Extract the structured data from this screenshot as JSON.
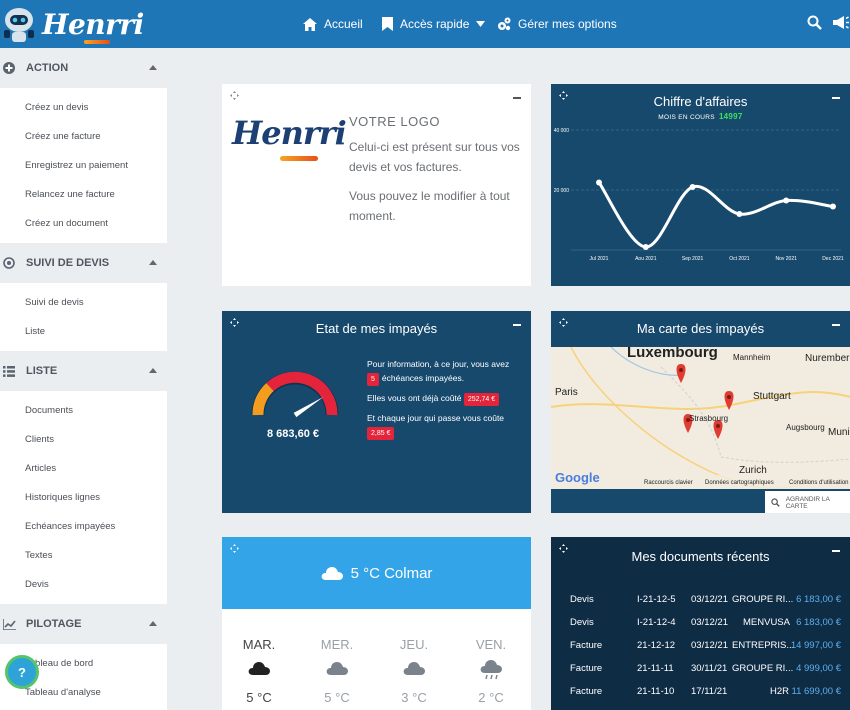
{
  "brand": {
    "name": "Henrri"
  },
  "nav": {
    "home_label": "Accueil",
    "quick_label": "Accès rapide",
    "options_label": "Gérer mes options"
  },
  "icons": {
    "home": "home-icon",
    "bookmark": "bookmark-icon",
    "caret": "caret-down-icon",
    "cogs": "cogs-icon",
    "search": "search-icon",
    "megaphone": "megaphone-icon",
    "drag": "move-icon",
    "minus": "minimize-icon",
    "cloud": "cloud-icon"
  },
  "sidebar": {
    "sections": [
      {
        "title": "ACTION",
        "icon": "plus-circle-icon",
        "items": [
          "Créez un devis",
          "Créez une facture",
          "Enregistrez un paiement",
          "Relancez une facture",
          "Créez un document"
        ]
      },
      {
        "title": "SUIVI DE DEVIS",
        "icon": "target-icon",
        "items": [
          "Suivi de devis",
          "Liste"
        ]
      },
      {
        "title": "LISTE",
        "icon": "list-icon",
        "items": [
          "Documents",
          "Clients",
          "Articles",
          "Historiques lignes",
          "Echéances impayées",
          "Textes",
          "Devis"
        ]
      },
      {
        "title": "PILOTAGE",
        "icon": "chart-icon",
        "items": [
          "Tableau de bord",
          "Tableau d'analyse"
        ]
      }
    ],
    "help_label": "?"
  },
  "logo_card": {
    "title": "VOTRE LOGO",
    "line1": "Celui-ci est présent sur tous vos devis et vos factures.",
    "line2": "Vous pouvez le modifier à tout moment."
  },
  "revenue_card": {
    "title": "Chiffre d'affaires",
    "subtitle": "MOIS EN COURS",
    "current": "14997"
  },
  "chart_data": {
    "type": "line",
    "title": "Chiffre d'affaires",
    "categories": [
      "Jul 2021",
      "Aou 2021",
      "Sep 2021",
      "Oct 2021",
      "Nov 2021",
      "Dec 2021"
    ],
    "series": [
      {
        "values": [
          22500,
          1000,
          21000,
          12000,
          16500,
          14500
        ]
      }
    ],
    "yticks": [
      "40 000",
      "20 000"
    ],
    "ylim": [
      0,
      40000
    ],
    "grid": true,
    "colors": {
      "line": "#ffffff",
      "grid": "#3e6b8c"
    }
  },
  "impayes_card": {
    "title": "Etat de mes impayés",
    "amount": "8 683,60 €",
    "info_pre": "Pour information, à ce jour, vous avez",
    "count": "5",
    "info_post": "échéances impayées.",
    "cost_label": "Elles vous ont déjà coûté",
    "cost": "252,74 €",
    "daily_label": "Et chaque jour qui passe vous coûte",
    "daily": "2,85 €",
    "gauge_level": 0.82
  },
  "map_card": {
    "title": "Ma carte des impayés",
    "places": [
      "Luxembourg",
      "Mannheim",
      "Nuremberg",
      "Paris",
      "Stuttgart",
      "Strasbourg",
      "Augsbourg",
      "Munich",
      "Zurich"
    ],
    "google": "Google",
    "footer": [
      "Raccourcis clavier",
      "Données cartographiques",
      "Conditions d'utilisation"
    ],
    "search_label": "AGRANDIR LA CARTE",
    "markers": 4
  },
  "weather_card": {
    "title": "5 °C Colmar",
    "days": [
      {
        "name": "MAR.",
        "temp": "5 °C",
        "icon": "cloud-dark-icon"
      },
      {
        "name": "MER.",
        "temp": "5 °C",
        "icon": "cloud-icon"
      },
      {
        "name": "JEU.",
        "temp": "3 °C",
        "icon": "cloud-icon"
      },
      {
        "name": "VEN.",
        "temp": "2 °C",
        "icon": "rain-cloud-icon"
      }
    ]
  },
  "documents_card": {
    "title": "Mes documents récents",
    "rows": [
      {
        "type": "Devis",
        "number": "I-21-12-5",
        "date": "03/12/21",
        "client": "GROUPE RI...",
        "amount": "6 183,00 €"
      },
      {
        "type": "Devis",
        "number": "I-21-12-4",
        "date": "03/12/21",
        "client": "MENVUSA",
        "amount": "6 183,00 €"
      },
      {
        "type": "Facture",
        "number": "21-12-12",
        "date": "03/12/21",
        "client": "ENTREPRIS...",
        "amount": "14 997,00 €"
      },
      {
        "type": "Facture",
        "number": "21-11-11",
        "date": "30/11/21",
        "client": "GROUPE RI...",
        "amount": "4 999,00 €"
      },
      {
        "type": "Facture",
        "number": "21-11-10",
        "date": "17/11/21",
        "client": "H2R",
        "amount": "11 699,00 €"
      }
    ]
  }
}
